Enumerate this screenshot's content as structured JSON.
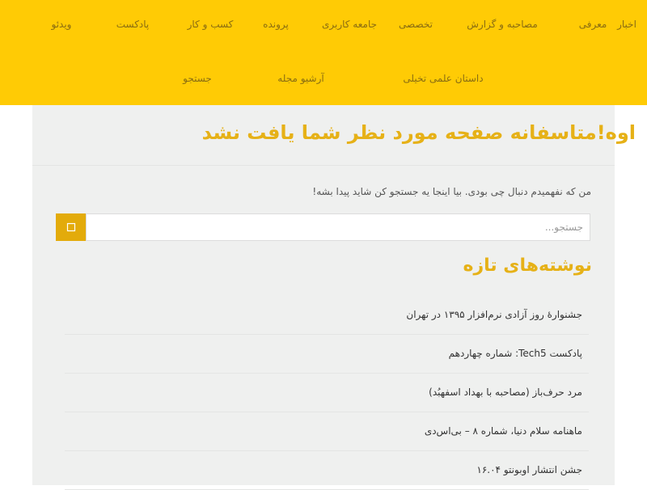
{
  "nav": {
    "row1": [
      "ویدئو",
      "پادکست",
      "کسب و کار",
      "پرونده",
      "جامعه کاربری",
      "تخصصی",
      "مصاحبه و گزارش",
      "معرفی",
      "اخبار",
      "."
    ],
    "row2": [
      "جستجو",
      "آرشیو مجله",
      "داستان علمی تخیلی"
    ]
  },
  "main": {
    "title": "اوه!متاسفانه صفحه مورد نظر شما یافت نشد",
    "message": "من که نفهمیدم دنبال چی بودی. بیا اینجا یه جستجو کن شاید پیدا بشه!",
    "search": {
      "placeholder": "جستجو...",
      "icon": "search-icon",
      "button_color": "#e3ab0b"
    }
  },
  "recent": {
    "title": "نوشته‌های تازه",
    "posts": [
      "جشنوارهٔ روز آزادی نرم‌افزار ۱۳۹۵ در تهران",
      "پادکست Tech5: شماره چهاردهم",
      "مرد حرف‌باز (مصاحبه با بهداد اسفهبُد)",
      "ماهنامه سلام دنیا، شماره ۸ – بی‌اس‌دی",
      "جشن انتشار اوبونتو ۱۶.۰۴"
    ]
  },
  "colors": {
    "header_bg": "#ffcb05",
    "accent": "#e6b117",
    "panel_bg": "#eff0ef"
  }
}
